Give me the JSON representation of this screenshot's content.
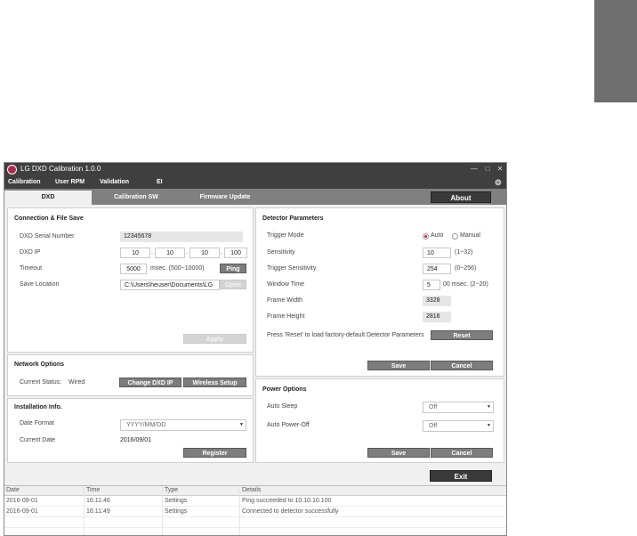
{
  "window": {
    "title": "LG DXD Calibration 1.0.0"
  },
  "menu": [
    "Calibration",
    "User RPM",
    "Validation",
    "EI"
  ],
  "tabs": [
    "DXD",
    "Calibration SW",
    "Firmware Update"
  ],
  "about_label": "About",
  "connection": {
    "title": "Connection & File Save",
    "serial_label": "DXD Serial Number",
    "serial_value": "12345678",
    "ip_label": "DXD IP",
    "ip": [
      "10",
      "10",
      "10",
      "100"
    ],
    "timeout_label": "Timeout",
    "timeout_value": "5000",
    "timeout_hint": "msec. (500~10000)",
    "ping_label": "Ping",
    "save_location_label": "Save Location",
    "save_location_value": "C:\\Users\\heuser\\Documents\\LG",
    "open_label": "Open",
    "apply_label": "Apply"
  },
  "network": {
    "title": "Network Options",
    "status_label": "Current Status:",
    "status_value": "Wired",
    "change_ip_label": "Change DXD IP",
    "wireless_label": "Wireless Setup"
  },
  "installation": {
    "title": "Installation Info.",
    "date_format_label": "Date Format",
    "date_format_value": "YYYY/MM/DD",
    "current_date_label": "Current Date",
    "current_date_value": "2016/09/01",
    "register_label": "Register"
  },
  "detector": {
    "title": "Detector Parameters",
    "trigger_mode_label": "Trigger Mode",
    "auto_label": "Auto",
    "manual_label": "Manual",
    "sensitivity_label": "Sensitivity",
    "sensitivity_value": "10",
    "sensitivity_hint": "(1~32)",
    "trigger_sens_label": "Trigger Sensitivity",
    "trigger_sens_value": "254",
    "trigger_sens_hint": "(0~256)",
    "window_time_label": "Window Time",
    "window_time_value": "5",
    "window_time_hint": "00 msec. (2~20)",
    "frame_width_label": "Frame Width",
    "frame_width_value": "3328",
    "frame_height_label": "Frame Height",
    "frame_height_value": "2816",
    "reset_hint": "Press 'Reset' to load factory-default Detector Parameters",
    "reset_label": "Reset",
    "save_label": "Save",
    "cancel_label": "Cancel"
  },
  "power": {
    "title": "Power Options",
    "sleep_label": "Auto Sleep",
    "sleep_value": "Off",
    "poweroff_label": "Auto Power-Off",
    "poweroff_value": "Off",
    "save_label": "Save",
    "cancel_label": "Cancel"
  },
  "exit_label": "Exit",
  "log": {
    "headers": [
      "Date",
      "Time",
      "Type",
      "Details"
    ],
    "rows": [
      [
        "2016-09-01",
        "16:11:46",
        "Settings",
        "Ping succeeded to  10.10.10.100"
      ],
      [
        "2016-09-01",
        "16:11:49",
        "Settings",
        "Connected to detector successfully"
      ]
    ]
  }
}
